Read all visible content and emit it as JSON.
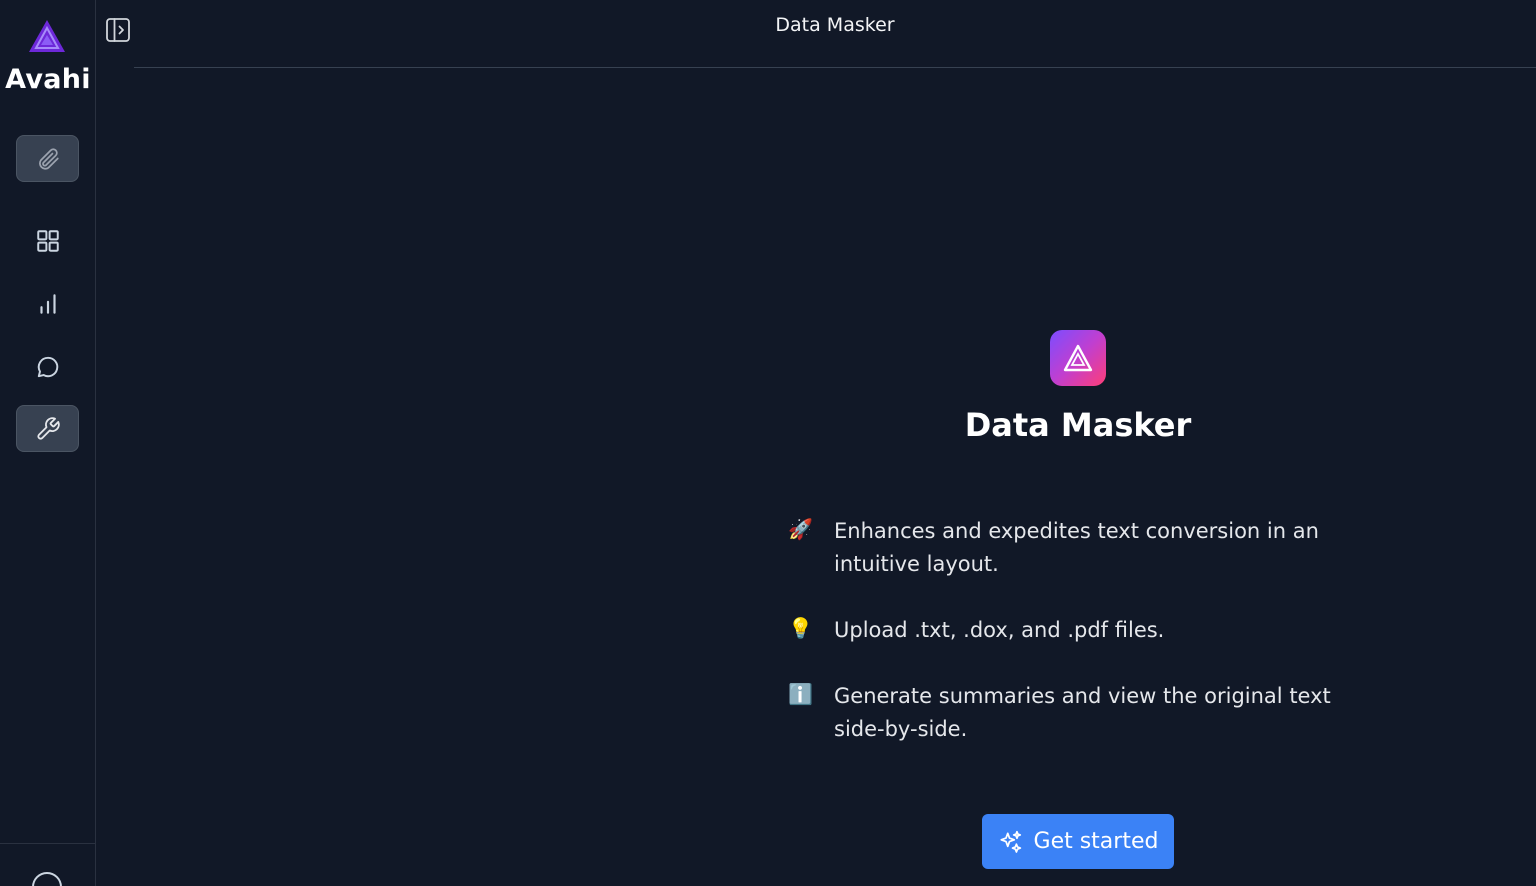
{
  "brand": {
    "name": "Avahi"
  },
  "sidebar": {
    "items": [
      {
        "name": "attachments",
        "icon": "paperclip-icon",
        "active": true
      },
      {
        "name": "dashboard",
        "icon": "grid-icon",
        "active": false
      },
      {
        "name": "analytics",
        "icon": "bar-chart-icon",
        "active": false
      },
      {
        "name": "chat",
        "icon": "chat-bubble-icon",
        "active": false
      },
      {
        "name": "tools",
        "icon": "wrench-icon",
        "active": true
      }
    ]
  },
  "header": {
    "title": "Data Masker"
  },
  "hero": {
    "title": "Data Masker",
    "features": [
      {
        "emoji": "🚀",
        "text": "Enhances and expedites text conversion in an intuitive layout."
      },
      {
        "emoji": "💡",
        "text": "Upload .txt, .dox, and .pdf files."
      },
      {
        "emoji": "ℹ️",
        "text": "Generate summaries and view the original text side-by-side."
      }
    ],
    "cta_label": "Get started"
  },
  "colors": {
    "background": "#111827",
    "accent": "#3b82f6",
    "brand_purple": "#7c3aed"
  }
}
